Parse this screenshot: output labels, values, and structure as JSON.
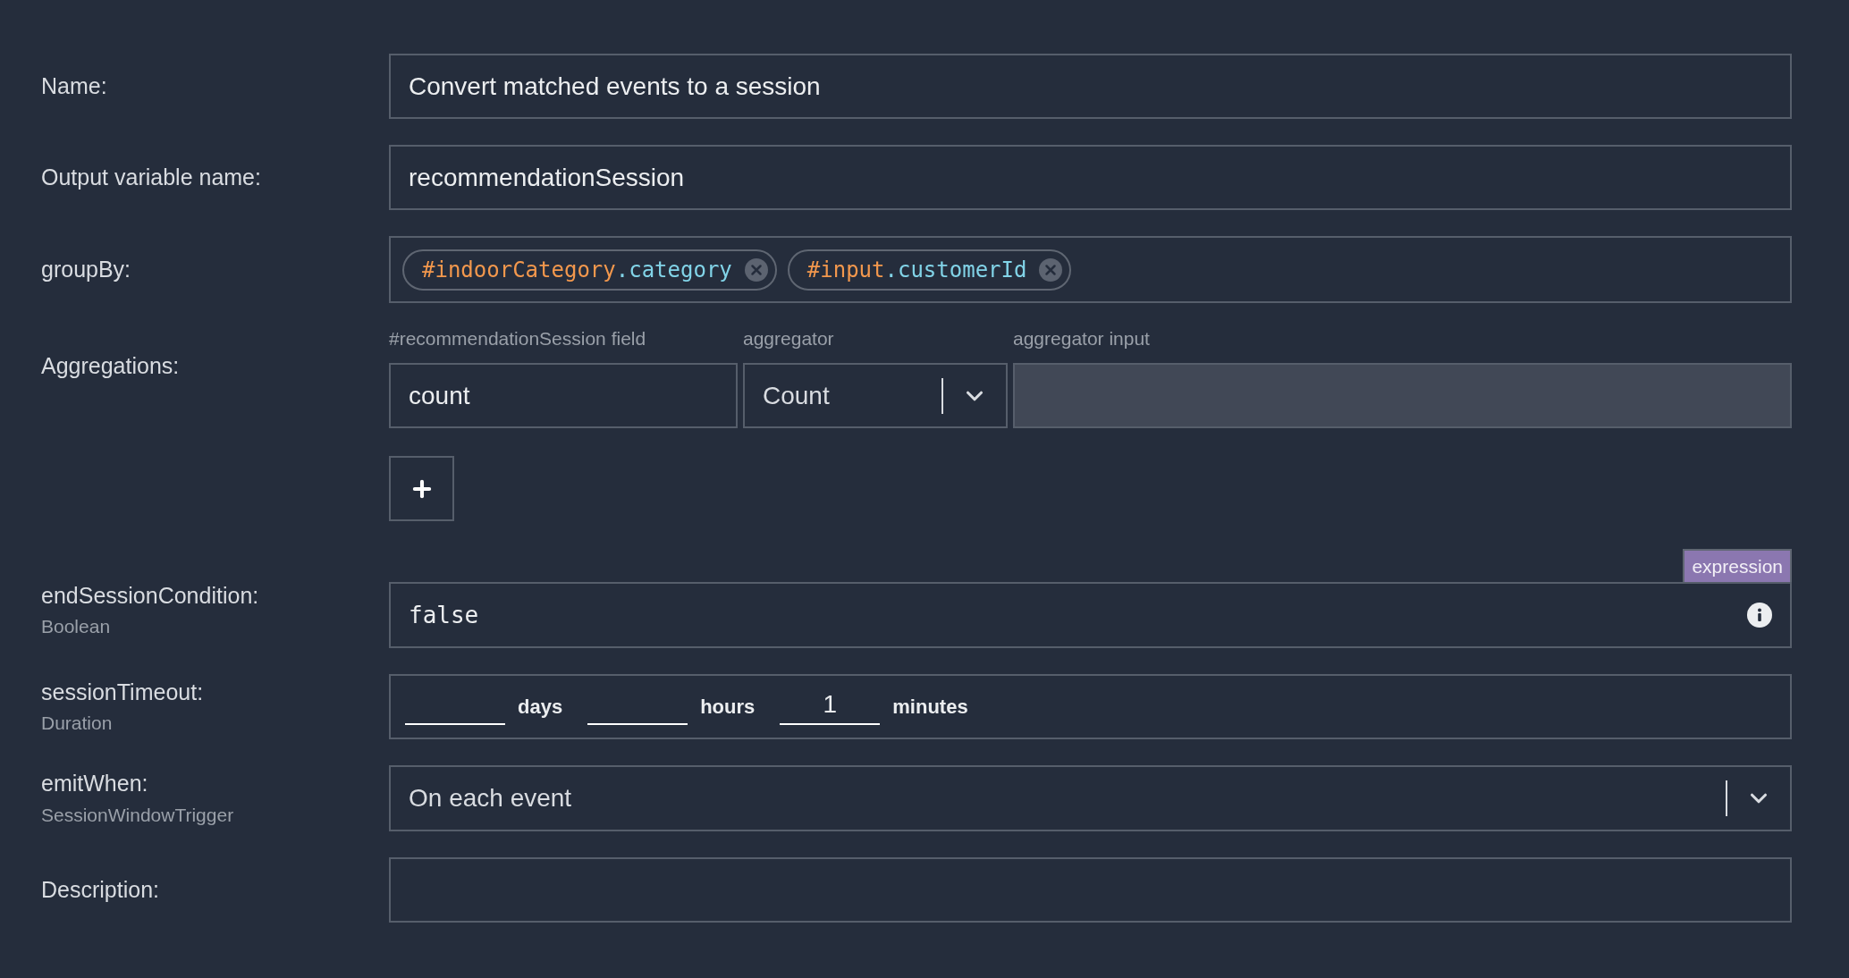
{
  "fields": [
    {
      "kind": "text",
      "label": "Name:",
      "value": "Convert matched events to a session"
    },
    {
      "kind": "text",
      "label": "Output variable name:",
      "value": "recommendationSession"
    },
    {
      "kind": "tags",
      "label": "groupBy:",
      "tags": [
        {
          "parts": [
            {
              "kind": "variable",
              "text": "#indoorCategory"
            },
            {
              "kind": "property",
              "text": ".category"
            }
          ]
        },
        {
          "parts": [
            {
              "kind": "variable",
              "text": "#input"
            },
            {
              "kind": "property",
              "text": ".customerId"
            }
          ]
        }
      ]
    },
    {
      "kind": "aggregations",
      "label": "Aggregations:",
      "columns": [
        "#recommendationSession field",
        "aggregator",
        "aggregator input"
      ],
      "rows": [
        {
          "field": "count",
          "aggregator": "Count",
          "input_disabled": true
        }
      ]
    },
    {
      "kind": "expression",
      "label": "endSessionCondition:",
      "type": "Boolean",
      "badge": "expression",
      "value": "false"
    },
    {
      "kind": "duration",
      "label": "sessionTimeout:",
      "type": "Duration",
      "units": [
        {
          "unit": "days"
        },
        {
          "unit": "hours"
        },
        {
          "value": "1",
          "unit": "minutes"
        }
      ]
    },
    {
      "kind": "select",
      "label": "emitWhen:",
      "type": "SessionWindowTrigger",
      "value": "On each event"
    },
    {
      "kind": "text",
      "label": "Description:"
    }
  ]
}
